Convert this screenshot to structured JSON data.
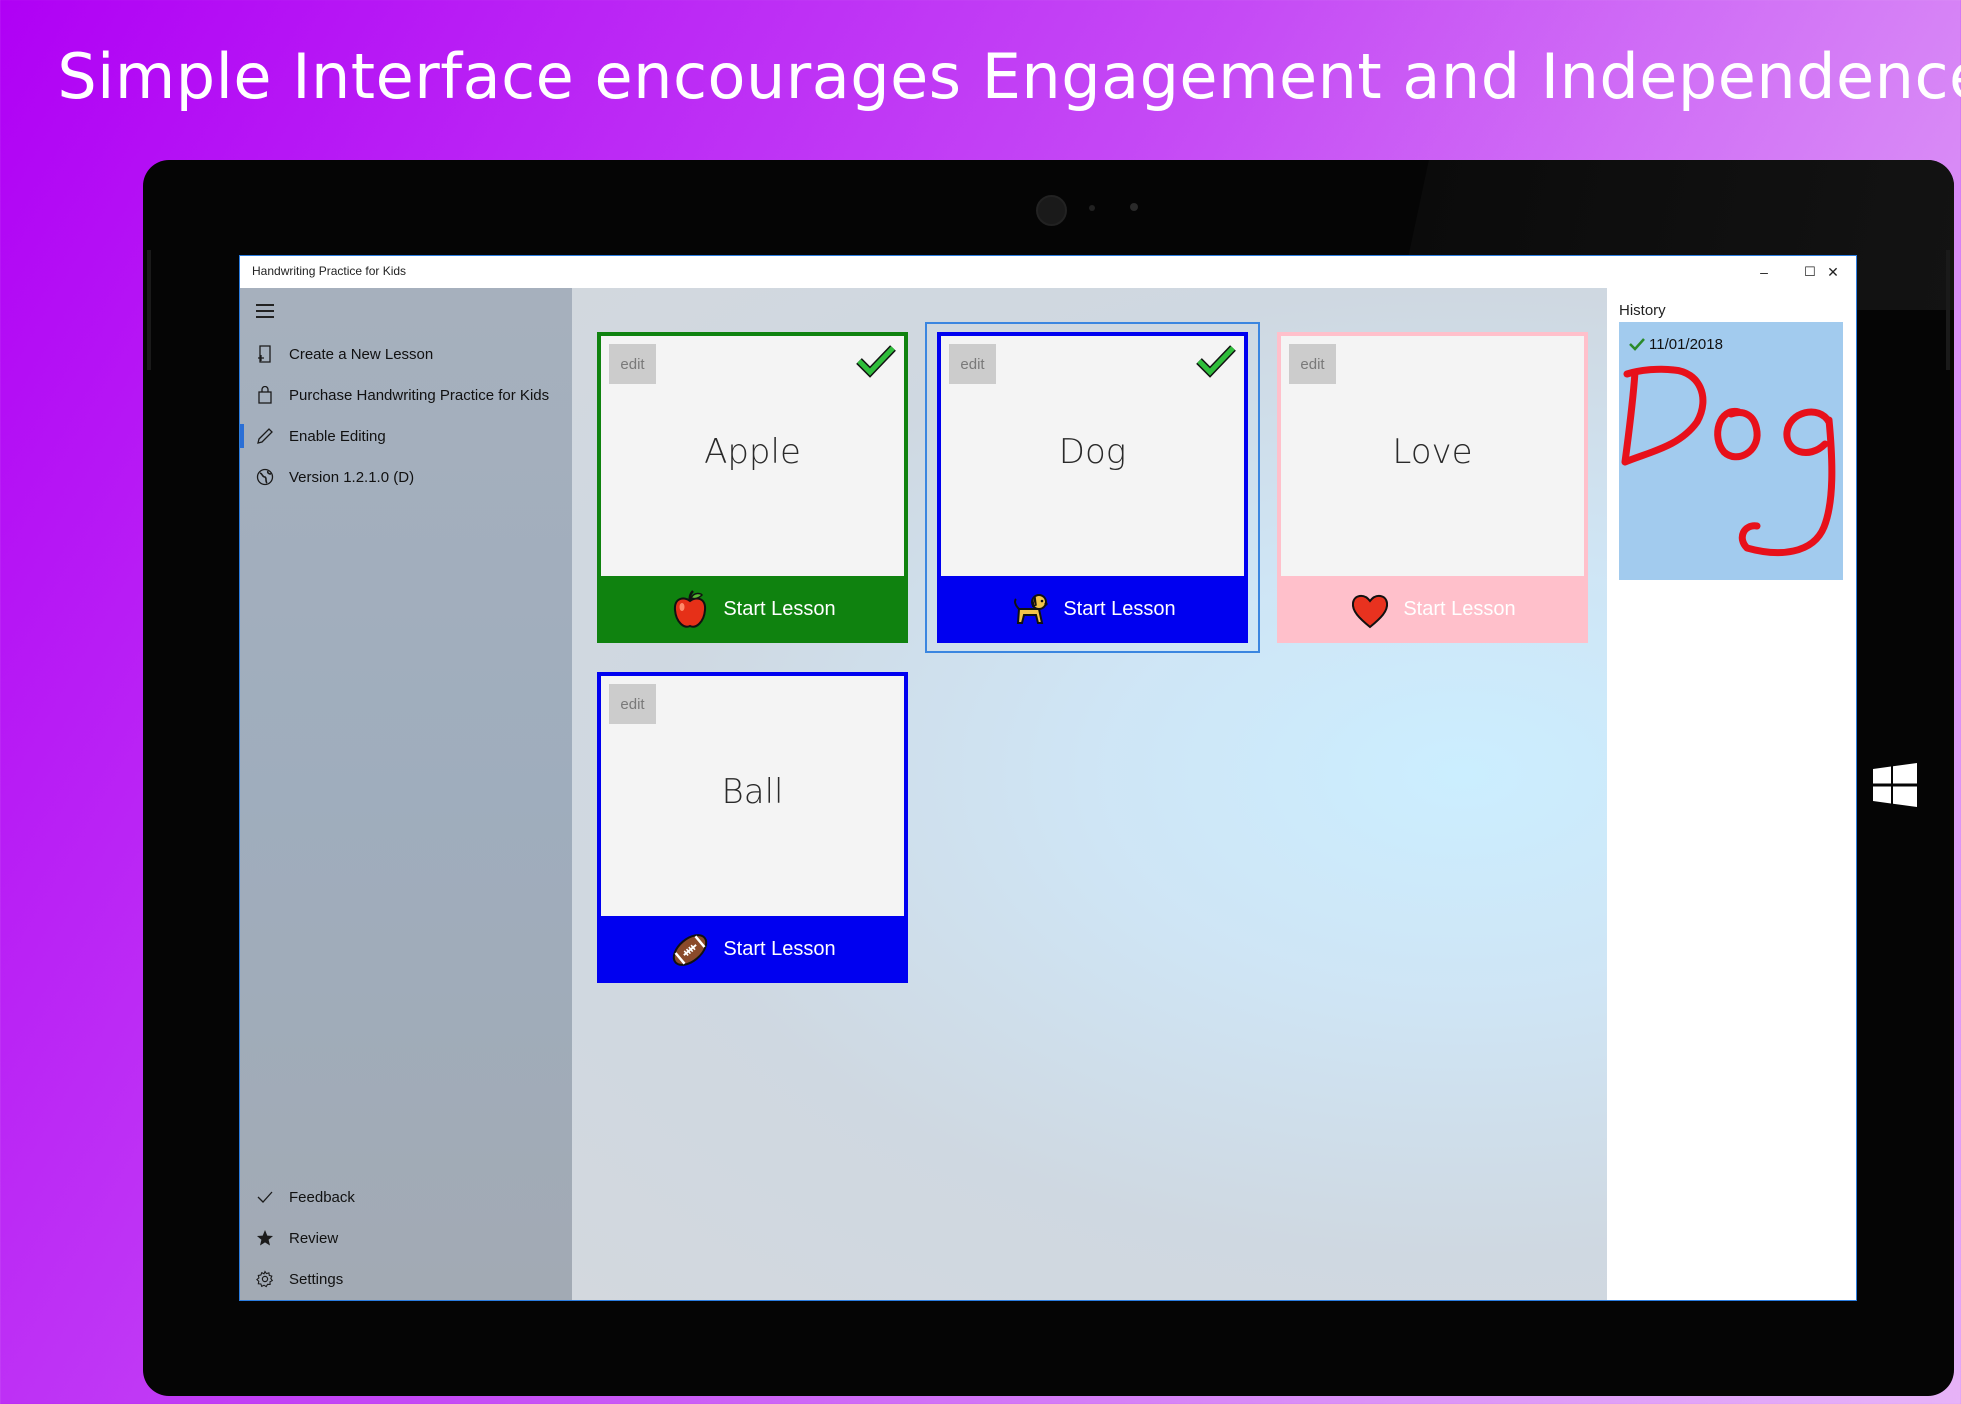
{
  "banner": {
    "text": "Simple Interface encourages Engagement and Independence"
  },
  "window": {
    "title": "Handwriting Practice for Kids",
    "controls": {
      "minimize": "–",
      "maximize": "☐",
      "close": "✕"
    }
  },
  "sidebar": {
    "items": [
      {
        "label": "Create a New Lesson",
        "icon": "new-lesson-icon"
      },
      {
        "label": "Purchase Handwriting Practice for Kids",
        "icon": "shopping-bag-icon"
      },
      {
        "label": "Enable Editing",
        "icon": "pencil-icon",
        "selected": true
      },
      {
        "label": "Version 1.2.1.0 (D)",
        "icon": "globe-icon"
      }
    ],
    "footer": [
      {
        "label": "Feedback",
        "icon": "check-icon"
      },
      {
        "label": "Review",
        "icon": "star-icon"
      },
      {
        "label": "Settings",
        "icon": "gear-icon"
      }
    ]
  },
  "lessons": [
    {
      "word": "Apple",
      "edit": "edit",
      "action": "Start Lesson",
      "completed": true,
      "icon": "apple-icon",
      "color": "#0f820f"
    },
    {
      "word": "Dog",
      "edit": "edit",
      "action": "Start Lesson",
      "completed": true,
      "icon": "dog-icon",
      "color": "#0000f0",
      "selected": true
    },
    {
      "word": "Love",
      "edit": "edit",
      "action": "Start Lesson",
      "completed": false,
      "icon": "heart-icon",
      "color": "#ffc0cb"
    },
    {
      "word": "Ball",
      "edit": "edit",
      "action": "Start Lesson",
      "completed": false,
      "icon": "football-icon",
      "color": "#0000f0"
    }
  ],
  "history": {
    "label": "History",
    "entries": [
      {
        "date": "11/01/2018",
        "completed": true,
        "drawing": "Dog"
      }
    ]
  }
}
